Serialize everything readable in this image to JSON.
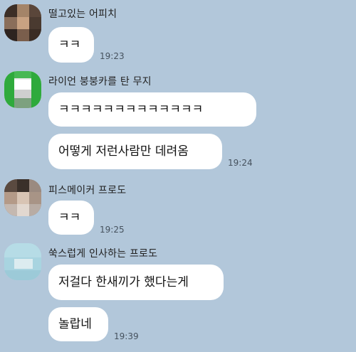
{
  "messages": [
    {
      "sender": "떨고있는 어피치",
      "bubbles": [
        {
          "text": "ㅋㅋ",
          "time": "19:23"
        }
      ]
    },
    {
      "sender": "라이언 붕붕카를 탄 무지",
      "bubbles": [
        {
          "text": "ㅋㅋㅋㅋㅋㅋㅋㅋㅋㅋㅋㅋㅋ",
          "time": ""
        },
        {
          "text": "어떻게 저런사람만 데려옴",
          "time": "19:24"
        }
      ]
    },
    {
      "sender": "피스메이커 프로도",
      "bubbles": [
        {
          "text": "ㅋㅋ",
          "time": "19:25"
        }
      ]
    },
    {
      "sender": "쑥스럽게 인사하는 프로도",
      "bubbles": [
        {
          "text": "저걸다 한새끼가 했다는게",
          "time": ""
        },
        {
          "text": "놀랍네",
          "time": "19:39"
        }
      ]
    }
  ],
  "colors": {
    "background": "#b2c7da",
    "bubble": "#ffffff",
    "time_text": "#46525e"
  }
}
